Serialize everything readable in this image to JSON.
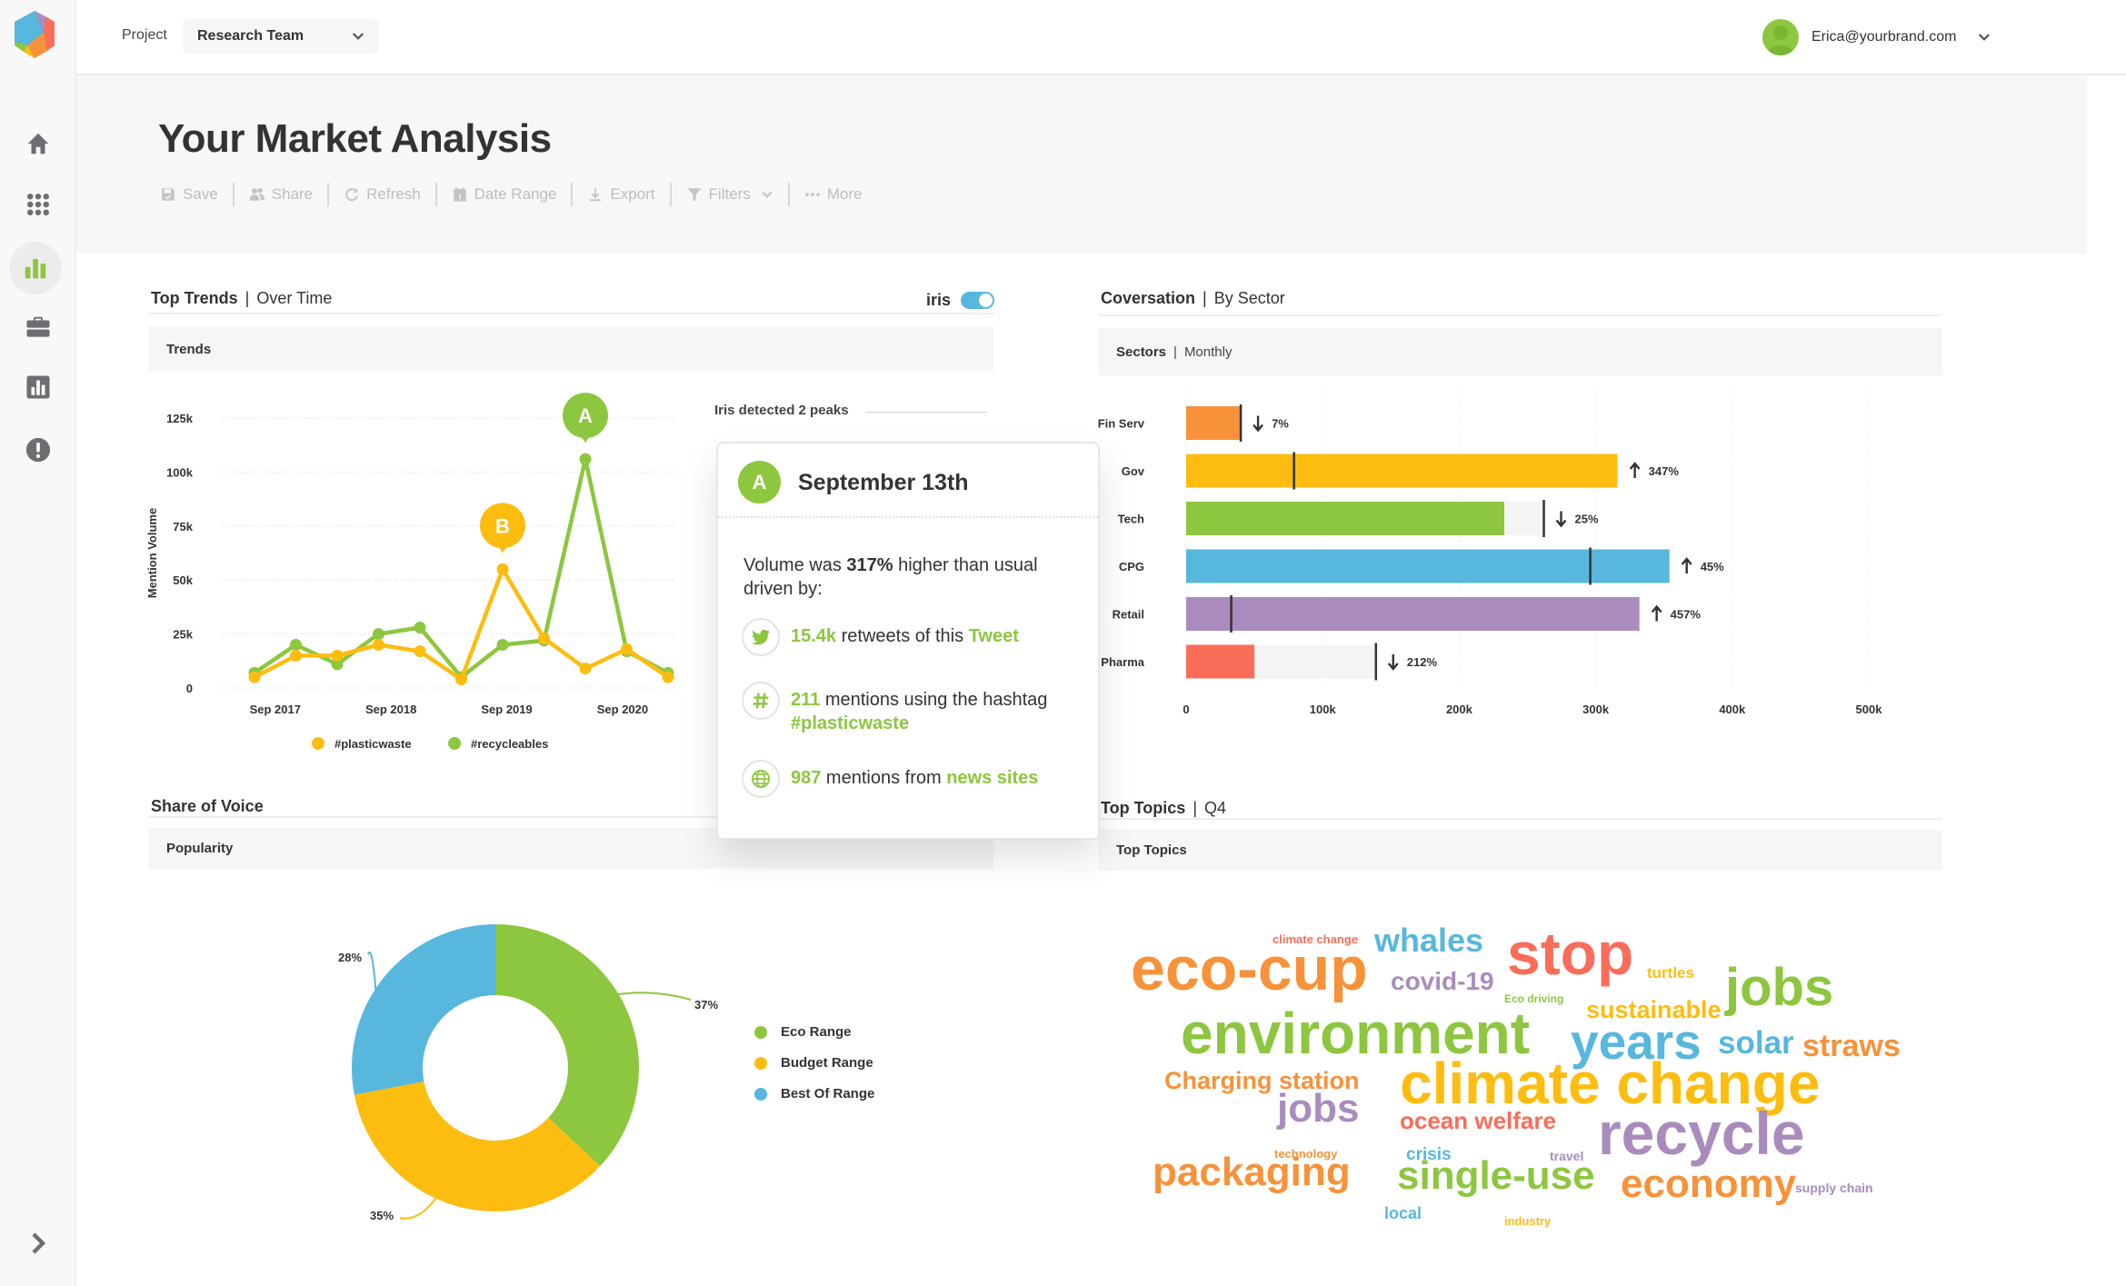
{
  "app": {
    "project_label": "Project",
    "project_value": "Research Team",
    "user_email": "Erica@yourbrand.com"
  },
  "sidebar": {
    "items": [
      {
        "name": "home",
        "icon": "home-icon",
        "active": false
      },
      {
        "name": "apps",
        "icon": "grid-icon",
        "active": false
      },
      {
        "name": "analytics",
        "icon": "bar-chart-icon",
        "active": true
      },
      {
        "name": "portfolio",
        "icon": "briefcase-icon",
        "active": false
      },
      {
        "name": "reports",
        "icon": "report-chart-icon",
        "active": false
      },
      {
        "name": "alerts",
        "icon": "alert-icon",
        "active": false
      }
    ],
    "expand_icon": "chevron-right-icon"
  },
  "header": {
    "title": "Your Market Analysis",
    "toolbar": [
      {
        "label": "Save",
        "icon": "save-icon"
      },
      {
        "label": "Share",
        "icon": "share-users-icon"
      },
      {
        "label": "Refresh",
        "icon": "refresh-icon"
      },
      {
        "label": "Date Range",
        "icon": "calendar-icon"
      },
      {
        "label": "Export",
        "icon": "download-icon"
      },
      {
        "label": "Filters",
        "icon": "filter-icon"
      },
      {
        "label": "More",
        "icon": "more-dots-icon"
      }
    ]
  },
  "trends": {
    "title": "Top Trends",
    "subtitle": "Over Time",
    "iris_label": "iris",
    "iris_enabled": true,
    "panel_label": "Trends",
    "peaks_label": "Iris detected 2 peaks",
    "peak_markers": [
      {
        "label": "A",
        "series": "#recycleables",
        "index": 8,
        "color": "#8dc63f"
      },
      {
        "label": "B",
        "series": "#plasticwaste",
        "index": 6,
        "color": "#fdbd10"
      }
    ]
  },
  "popup": {
    "badge": "A",
    "date": "September 13th",
    "summary_pre": "Volume was ",
    "summary_value": "317%",
    "summary_post": " higher than usual driven by:",
    "drivers": [
      {
        "icon": "twitter-icon",
        "value": "15.4k",
        "text": " retweets of this ",
        "link": "Tweet"
      },
      {
        "icon": "hashtag-icon",
        "value": "211",
        "text": " mentions using the hashtag ",
        "link": "#plasticwaste"
      },
      {
        "icon": "globe-icon",
        "value": "987",
        "text": " mentions from ",
        "link": "news sites"
      }
    ]
  },
  "sectors": {
    "title": "Coversation",
    "subtitle": "By Sector",
    "panel_label": "Sectors",
    "panel_sub": "Monthly"
  },
  "share_of_voice": {
    "title": "Share of Voice",
    "panel_label": "Popularity"
  },
  "topics": {
    "title": "Top Topics",
    "subtitle": "Q4",
    "panel_label": "Top Topics",
    "words": [
      {
        "text": "eco-cup",
        "color": "#f7923a",
        "weight": 5
      },
      {
        "text": "climate change",
        "color": "#fa6d59",
        "weight": 1
      },
      {
        "text": "whales",
        "color": "#57b7dd",
        "weight": 3
      },
      {
        "text": "stop",
        "color": "#fa6d59",
        "weight": 5
      },
      {
        "text": "turtles",
        "color": "#fdbd10",
        "weight": 1
      },
      {
        "text": "jobs",
        "color": "#8dc63f",
        "weight": 4
      },
      {
        "text": "covid-19",
        "color": "#a98cbd",
        "weight": 2
      },
      {
        "text": "Eco driving",
        "color": "#8dc63f",
        "weight": 1
      },
      {
        "text": "sustainable",
        "color": "#fdbd10",
        "weight": 2
      },
      {
        "text": "environment",
        "color": "#8dc63f",
        "weight": 5
      },
      {
        "text": "years",
        "color": "#57b7dd",
        "weight": 4
      },
      {
        "text": "solar",
        "color": "#57b7dd",
        "weight": 3
      },
      {
        "text": "straws",
        "color": "#f7923a",
        "weight": 3
      },
      {
        "text": "Charging station",
        "color": "#f7923a",
        "weight": 2
      },
      {
        "text": "climate change",
        "color": "#fdbd10",
        "weight": 5
      },
      {
        "text": "jobs",
        "color": "#a98cbd",
        "weight": 3
      },
      {
        "text": "ocean welfare",
        "color": "#fa6d59",
        "weight": 2
      },
      {
        "text": "recycle",
        "color": "#a98cbd",
        "weight": 5
      },
      {
        "text": "technology",
        "color": "#f7923a",
        "weight": 1
      },
      {
        "text": "crisis",
        "color": "#57b7dd",
        "weight": 1
      },
      {
        "text": "travel",
        "color": "#a98cbd",
        "weight": 1
      },
      {
        "text": "packaging",
        "color": "#f7923a",
        "weight": 3
      },
      {
        "text": "single-use",
        "color": "#8dc63f",
        "weight": 3
      },
      {
        "text": "economy",
        "color": "#f7923a",
        "weight": 3
      },
      {
        "text": "supply chain",
        "color": "#a98cbd",
        "weight": 1
      },
      {
        "text": "local",
        "color": "#57b7dd",
        "weight": 1
      },
      {
        "text": "industry",
        "color": "#fdbd10",
        "weight": 1
      }
    ]
  },
  "chart_data": [
    {
      "type": "line",
      "title": "Trends",
      "xlabel": "",
      "ylabel": "Mention Volume",
      "ylim": [
        0,
        125000
      ],
      "yticks": [
        0,
        25000,
        50000,
        75000,
        100000,
        125000
      ],
      "ytick_labels": [
        "0",
        "25k",
        "50k",
        "75k",
        "100k",
        "125k"
      ],
      "xtick_labels": [
        "Sep 2017",
        "Sep 2018",
        "Sep 2019",
        "Sep 2020"
      ],
      "xtick_positions": [
        0.5,
        3.3,
        6.1,
        8.9
      ],
      "x": [
        0,
        1,
        2,
        3,
        4,
        5,
        6,
        7,
        8,
        9,
        10
      ],
      "grid": true,
      "legend": "bottom",
      "series": [
        {
          "name": "#plasticwaste",
          "color": "#fdbd10",
          "values": [
            5000,
            15000,
            15000,
            20000,
            17000,
            4000,
            55000,
            23000,
            9000,
            18000,
            5000
          ]
        },
        {
          "name": "#recycleables",
          "color": "#8dc63f",
          "values": [
            7000,
            20000,
            11000,
            25000,
            28000,
            5000,
            20000,
            22000,
            106000,
            17000,
            7000
          ]
        }
      ]
    },
    {
      "type": "bar",
      "orientation": "horizontal",
      "title": "Sectors | Monthly",
      "categories": [
        "Fin Serv",
        "Gov",
        "Tech",
        "CPG",
        "Retail",
        "Pharma"
      ],
      "values": [
        40000,
        316000,
        233000,
        354000,
        332000,
        50000
      ],
      "benchmarks": [
        40000,
        79000,
        262000,
        296000,
        33000,
        139000
      ],
      "changes": [
        {
          "direction": "down",
          "label": "7%"
        },
        {
          "direction": "up",
          "label": "347%"
        },
        {
          "direction": "down",
          "label": "25%"
        },
        {
          "direction": "up",
          "label": "45%"
        },
        {
          "direction": "up",
          "label": "457%"
        },
        {
          "direction": "down",
          "label": "212%"
        }
      ],
      "colors": [
        "#f7923a",
        "#fdbd10",
        "#8dc63f",
        "#57b7dd",
        "#a98cbd",
        "#fa6d59"
      ],
      "xlim": [
        0,
        500000
      ],
      "xticks": [
        0,
        100000,
        200000,
        300000,
        400000,
        500000
      ],
      "xtick_labels": [
        "0",
        "100k",
        "200k",
        "300k",
        "400k",
        "500k"
      ],
      "grid": true
    },
    {
      "type": "pie",
      "donut": true,
      "title": "Popularity",
      "categories": [
        "Eco Range",
        "Budget Range",
        "Best Of Range"
      ],
      "values": [
        37,
        35,
        28
      ],
      "labels": [
        "37%",
        "35%",
        "28%"
      ],
      "colors": [
        "#8dc63f",
        "#fdbd10",
        "#57b7dd"
      ],
      "legend": "right"
    }
  ]
}
